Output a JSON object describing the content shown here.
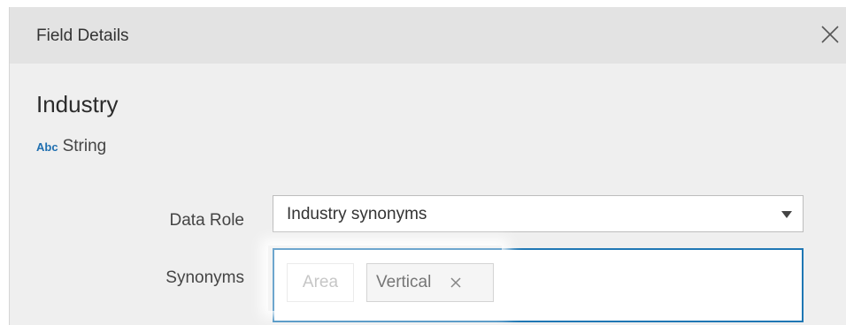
{
  "dialog": {
    "title": "Field Details",
    "close_icon": "close-icon"
  },
  "field": {
    "name": "Industry",
    "type_icon_text": "Abc",
    "type_label": "String"
  },
  "data_role": {
    "label": "Data Role",
    "selected": "Industry synonyms",
    "dropdown_icon": "chevron-down-icon"
  },
  "synonyms": {
    "label": "Synonyms",
    "chips": [
      {
        "text": "Area",
        "state": "placeholder"
      },
      {
        "text": "Vertical",
        "removable": true
      }
    ],
    "focus_color": "#1f77b4"
  },
  "colors": {
    "titlebar": "#e3e3e3",
    "dialog_bg": "#efefef",
    "type_icon": "#1f6fb0"
  }
}
